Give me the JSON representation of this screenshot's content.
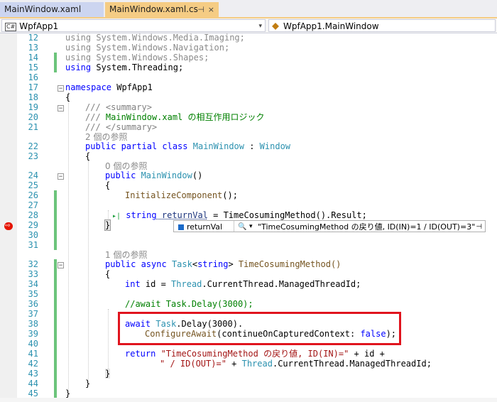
{
  "tabs": [
    {
      "label": "MainWindow.xaml"
    },
    {
      "label": "MainWindow.xaml.cs",
      "pin_icon": "⊣",
      "close_icon": "×"
    }
  ],
  "nav": {
    "project_icon": "C#",
    "project": "WpfApp1",
    "class": "WpfApp1.MainWindow",
    "dropdown_arrow": "▾"
  },
  "line_numbers": [
    "12",
    "13",
    "14",
    "15",
    "16",
    "17",
    "18",
    "19",
    "20",
    "21",
    "22",
    "23",
    "24",
    "25",
    "26",
    "27",
    "28",
    "29",
    "30",
    "31",
    "32",
    "33",
    "34",
    "35",
    "36",
    "37",
    "38",
    "39",
    "40",
    "41",
    "42",
    "43",
    "44",
    "45"
  ],
  "code": {
    "l12": {
      "kw": "using",
      "rest": " System.Windows.Media.Imaging;"
    },
    "l13": {
      "kw": "using",
      "rest": " System.Windows.Navigation;"
    },
    "l14": {
      "kw": "using",
      "rest": " System.Windows.Shapes;"
    },
    "l15": {
      "kw": "using",
      "rest": " System.Threading;"
    },
    "l17": {
      "kw": "namespace",
      "rest": " WpfApp1"
    },
    "l18": "{",
    "l19": "/// <summary>",
    "l20": {
      "slashes": "///",
      "text": " MainWindow.xaml の相互作用ロジック"
    },
    "l21": "/// </summary>",
    "refs_class": "2 個の参照",
    "l22": {
      "kw1": "public",
      "kw2": " partial",
      "kw3": " class",
      "name": " MainWindow",
      "colon": " :",
      "base": " Window"
    },
    "l23": "{",
    "refs_ctor": "0 個の参照",
    "l24": {
      "kw": "public",
      "name": " MainWindow",
      "rest": "()"
    },
    "l25": "{",
    "l26": {
      "name": "InitializeComponent",
      "rest": "();"
    },
    "l28": {
      "arrow": "▸|",
      "kw": "string",
      "var": " returnVal",
      "rest": " = TimeCosumingMethod().Result;"
    },
    "l29": "}",
    "datatip": {
      "var": "returnVal",
      "search_icon": "🔍",
      "arrow": "▾",
      "value": "\"TimeCosumingMethod の戻り値, ID(IN)=1 / ID(OUT)=3\"",
      "pin_icon": "⊣"
    },
    "refs_method": "1 個の参照",
    "l32": {
      "kw1": "public",
      "kw2": " async",
      "type": " Task",
      "gen": "<",
      "gkw": "string",
      "gen2": ">",
      "rest": " TimeCosumingMethod()"
    },
    "l33": "{",
    "l34": {
      "kw": "int",
      "rest1": " id = ",
      "type": "Thread",
      "rest2": ".CurrentThread.ManagedThreadId;"
    },
    "l36": "//await Task.Delay(3000);",
    "l38": {
      "kw": "await",
      "type": " Task",
      "rest": ".Delay(3000)."
    },
    "l39": {
      "method": "ConfigureAwait",
      "rest1": "(continueOnCapturedContext: ",
      "kw": "false",
      "rest2": ");"
    },
    "l41": {
      "kw": "return",
      "str": " \"TimeCosumingMethod の戻り値, ID(IN)=\"",
      "rest": " + id +"
    },
    "l42": {
      "str": "\" / ID(OUT)=\"",
      "rest1": " + ",
      "type": "Thread",
      "rest2": ".CurrentThread.ManagedThreadId;"
    },
    "l43": "}",
    "l44": "}",
    "l45": "}"
  },
  "fold_glyph": "−",
  "colors": {
    "keyword": "#0000ff",
    "type": "#2b91af",
    "comment": "#008000",
    "string": "#a31515",
    "highlight_box": "#e0141e",
    "breakpoint": "#e51400",
    "active_tab": "#f5cc84"
  }
}
